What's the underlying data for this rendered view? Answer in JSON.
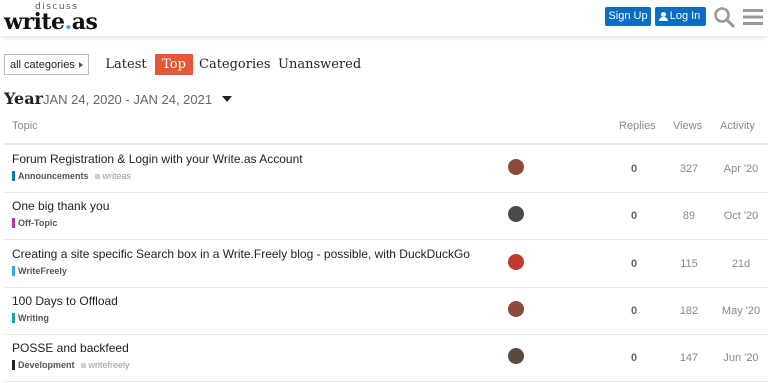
{
  "header": {
    "logo_small": "discuss",
    "logo_main": "write",
    "logo_dot": ".",
    "logo_tld": "as",
    "signup_label": "Sign Up",
    "login_label": "Log In"
  },
  "nav": {
    "category_dropdown": "all categories",
    "tabs": [
      {
        "label": "Latest",
        "active": false
      },
      {
        "label": "Top",
        "active": true
      },
      {
        "label": "Categories",
        "active": false
      },
      {
        "label": "Unanswered",
        "active": false
      }
    ]
  },
  "period": {
    "label": "Year",
    "range": "JAN 24, 2020 - JAN 24, 2021"
  },
  "table": {
    "headers": {
      "topic": "Topic",
      "replies": "Replies",
      "views": "Views",
      "activity": "Activity"
    },
    "rows": [
      {
        "title": "Forum Registration & Login with your Write.as Account",
        "category": "Announcements",
        "category_color": "#0e76bd",
        "tag": "writeas",
        "replies": "0",
        "views": "327",
        "activity": "Apr '20",
        "avatar_color": "#8a4a3c"
      },
      {
        "title": "One big thank you",
        "category": "Off-Topic",
        "category_color": "#b0379b",
        "tag": "",
        "replies": "0",
        "views": "89",
        "activity": "Oct '20",
        "avatar_color": "#4a4a4a"
      },
      {
        "title": "Creating a site specific Search box in a Write.Freely blog - possible, with DuckDuckGo",
        "category": "WriteFreely",
        "category_color": "#3aa8e0",
        "tag": "",
        "replies": "0",
        "views": "115",
        "activity": "21d",
        "avatar_color": "#c0392b"
      },
      {
        "title": "100 Days to Offload",
        "category": "Writing",
        "category_color": "#12a89d",
        "tag": "",
        "replies": "0",
        "views": "182",
        "activity": "May '20",
        "avatar_color": "#8a4a3c"
      },
      {
        "title": "POSSE and backfeed",
        "category": "Development",
        "category_color": "#231f20",
        "tag": "writefreely",
        "replies": "0",
        "views": "147",
        "activity": "Jun '20",
        "avatar_color": "#5a4a3a"
      }
    ]
  },
  "colors": {
    "primary_button": "#0a6dc2",
    "active_tab": "#e45735",
    "link_accent": "#3aa8e0"
  },
  "icons": {
    "search": "search-icon",
    "menu": "hamburger-menu-icon",
    "user": "user-icon",
    "caret": "caret-down-icon"
  }
}
